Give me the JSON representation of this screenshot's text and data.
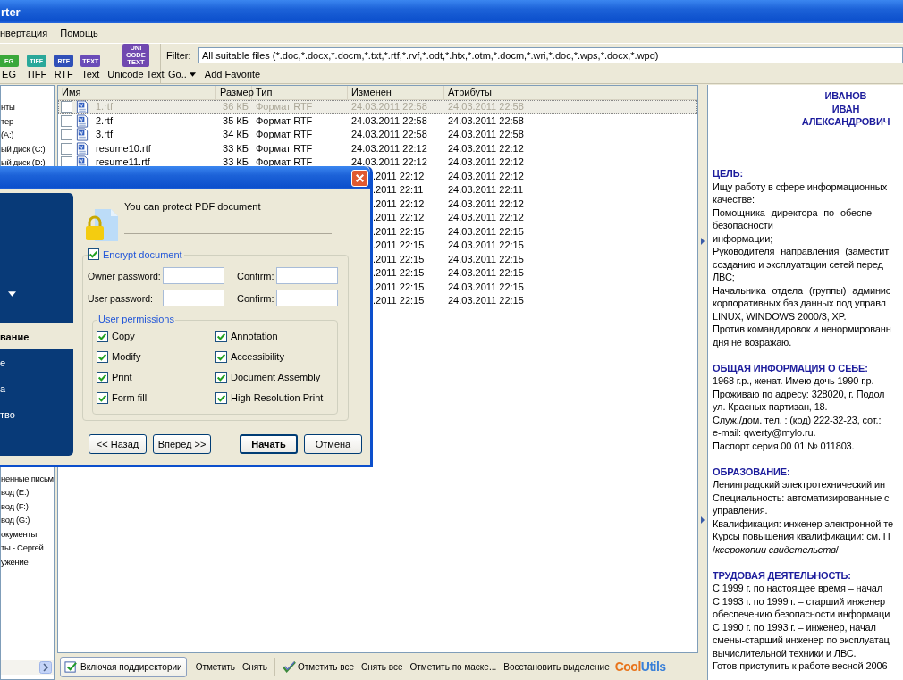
{
  "window": {
    "title": "rter"
  },
  "menu": [
    {
      "label": "нвертация"
    },
    {
      "label": "Помощь"
    }
  ],
  "tools": [
    {
      "label": "EG",
      "icon_text": "EG",
      "color": "#3aa83a"
    },
    {
      "label": "TIFF",
      "icon_text": "TIFF",
      "color": "#2aa89a"
    },
    {
      "label": "RTF",
      "icon_text": "RTF",
      "color": "#3050b8"
    },
    {
      "label": "Text",
      "icon_text": "TEXT",
      "color": "#6a4cb8"
    },
    {
      "label": "Unicode Text",
      "icon_text": "UNI CODE TEXT",
      "color": "#7048b0"
    }
  ],
  "filter": {
    "label": "Filter:",
    "value": "All suitable files (*.doc,*.docx,*.docm,*.txt,*.rtf,*.rvf,*.odt,*.htx,*.otm,*.docm,*.wri,*.doc,*.wps,*.docx,*.wpd)"
  },
  "go": {
    "label": "Go..",
    "add_favorite": "Add Favorite"
  },
  "tree": {
    "items": [
      {
        "label": "нты"
      },
      {
        "label": "тер"
      },
      {
        "label": "(A:)"
      },
      {
        "label": "ый диск (C:)"
      },
      {
        "label": "ый диск (D:)"
      },
      {
        "label": "ненные письм"
      },
      {
        "label": "вод (E:)"
      },
      {
        "label": "вод (F:)"
      },
      {
        "label": "вод (G:)"
      },
      {
        "label": "окументы"
      },
      {
        "label": "ты - Сергей"
      },
      {
        "label": "ужение"
      }
    ]
  },
  "files": {
    "columns": [
      "Имя",
      "Размер",
      "Тип",
      "Изменен",
      "Атрибуты"
    ],
    "rows": [
      {
        "name": "1.rtf",
        "size": "36 КБ",
        "type": "Формат RTF",
        "modified": "24.03.2011 22:58",
        "attributes": "24.03.2011 22:58",
        "checked": false,
        "selected": true
      },
      {
        "name": "2.rtf",
        "size": "35 КБ",
        "type": "Формат RTF",
        "modified": "24.03.2011 22:58",
        "attributes": "24.03.2011 22:58",
        "checked": false,
        "selected": false
      },
      {
        "name": "3.rtf",
        "size": "34 КБ",
        "type": "Формат RTF",
        "modified": "24.03.2011 22:58",
        "attributes": "24.03.2011 22:58",
        "checked": false,
        "selected": false
      },
      {
        "name": "resume10.rtf",
        "size": "33 КБ",
        "type": "Формат RTF",
        "modified": "24.03.2011 22:12",
        "attributes": "24.03.2011 22:12",
        "checked": false,
        "selected": false
      },
      {
        "name": "resume11.rtf",
        "size": "33 КБ",
        "type": "Формат RTF",
        "modified": "24.03.2011 22:12",
        "attributes": "24.03.2011 22:12",
        "checked": false,
        "selected": false
      },
      {
        "modified": ".2011 22:12",
        "attributes": "24.03.2011 22:12",
        "selected": false
      },
      {
        "modified": ".2011 22:11",
        "attributes": "24.03.2011 22:11",
        "selected": false
      },
      {
        "modified": ".2011 22:12",
        "attributes": "24.03.2011 22:12",
        "selected": false
      },
      {
        "modified": ".2011 22:12",
        "attributes": "24.03.2011 22:12",
        "selected": false
      },
      {
        "modified": ".2011 22:15",
        "attributes": "24.03.2011 22:15",
        "selected": false
      },
      {
        "modified": ".2011 22:15",
        "attributes": "24.03.2011 22:15",
        "selected": false
      },
      {
        "modified": ".2011 22:15",
        "attributes": "24.03.2011 22:15",
        "selected": false
      },
      {
        "modified": ".2011 22:15",
        "attributes": "24.03.2011 22:15",
        "selected": false
      },
      {
        "modified": ".2011 22:15",
        "attributes": "24.03.2011 22:15",
        "selected": false
      },
      {
        "modified": ".2011 22:15",
        "attributes": "24.03.2011 22:15",
        "selected": false
      }
    ]
  },
  "dialog": {
    "panel_items": [
      {
        "label": "вание",
        "selected": true
      },
      {
        "label": "е",
        "selected": false
      },
      {
        "label": "а",
        "selected": false
      },
      {
        "label": "тво",
        "selected": false
      }
    ],
    "heading": "You can protect PDF document",
    "encrypt": {
      "label": "Encrypt document",
      "checked": true
    },
    "fields": [
      {
        "label": "Owner password:",
        "confirm_label": "Confirm:"
      },
      {
        "label": "User password:",
        "confirm_label": "Confirm:"
      }
    ],
    "permissions": {
      "title": "User permissions",
      "items": [
        {
          "label": "Copy",
          "checked": true
        },
        {
          "label": "Annotation",
          "checked": true
        },
        {
          "label": "Modify",
          "checked": true
        },
        {
          "label": "Accessibility",
          "checked": true
        },
        {
          "label": "Print",
          "checked": true
        },
        {
          "label": "Document Assembly",
          "checked": true
        },
        {
          "label": "Form fill",
          "checked": true
        },
        {
          "label": "High Resolution Print",
          "checked": true
        }
      ]
    },
    "buttons": [
      {
        "label": "<< Назад",
        "kind": "normal"
      },
      {
        "label": "Вперед >>",
        "kind": "normal"
      },
      {
        "label": "Начать",
        "kind": "default"
      },
      {
        "label": "Отмена",
        "kind": "normal"
      }
    ]
  },
  "document": {
    "lines": [
      {
        "kind": "title",
        "text": "ИВАНОВ"
      },
      {
        "kind": "title",
        "text": "ИВАН"
      },
      {
        "kind": "title",
        "text": "АЛЕКСАНДРОВИЧ"
      },
      {
        "kind": "blank"
      },
      {
        "kind": "blank"
      },
      {
        "kind": "blank"
      },
      {
        "kind": "heading",
        "text": "ЦЕЛЬ:"
      },
      {
        "kind": "text",
        "text": "Ищу работу в сфере информационных"
      },
      {
        "kind": "text",
        "text": "качестве:"
      },
      {
        "kind": "justified",
        "text": " Помощника директора по обеспе"
      },
      {
        "kind": "text",
        "text": "безопасности"
      },
      {
        "kind": "text",
        "text": "информации;"
      },
      {
        "kind": "justified",
        "text": " Руководителя направления (заместит"
      },
      {
        "kind": "text",
        "text": "созданию  и эксплуатации сетей перед"
      },
      {
        "kind": "text",
        "text": "ЛВС;"
      },
      {
        "kind": "justified",
        "text": " Начальника отдела (группы) админис"
      },
      {
        "kind": "text",
        "text": "корпоративных баз данных под управл"
      },
      {
        "kind": "text",
        "text": "LINUX, WINDOWS 2000/3, XP."
      },
      {
        "kind": "text",
        "text": "Против командировок и ненормированн"
      },
      {
        "kind": "text",
        "text": "дня не возражаю."
      },
      {
        "kind": "blank"
      },
      {
        "kind": "heading",
        "text": "ОБЩАЯ ИНФОРМАЦИЯ О СЕБЕ:"
      },
      {
        "kind": "text",
        "text": "1968 г.р., женат. Имею дочь 1990 г.р."
      },
      {
        "kind": "text",
        "text": "Проживаю по адресу:  328020, г. Подол"
      },
      {
        "kind": "text",
        "text": "ул. Красных партизан, 18."
      },
      {
        "kind": "text",
        "text": "Служ./дом. тел. : (код) 222-32-23, сот.:"
      },
      {
        "kind": "text",
        "text": "e-mail: qwerty@mylo.ru."
      },
      {
        "kind": "text",
        "text": "Паспорт серия 00 01 № 011803."
      },
      {
        "kind": "blank"
      },
      {
        "kind": "heading",
        "text": "ОБРАЗОВАНИЕ:"
      },
      {
        "kind": "text",
        "text": "Ленинградский электротехнический ин"
      },
      {
        "kind": "text",
        "text": "Специальность: автоматизированные с"
      },
      {
        "kind": "text",
        "text": "управления."
      },
      {
        "kind": "text",
        "text": "Квалификация: инженер электронной те"
      },
      {
        "kind": "text",
        "text": "Курсы повышения квалификации: см. П"
      },
      {
        "kind": "text",
        "text": "/*ксерокопии свидетельств*/"
      },
      {
        "kind": "blank"
      },
      {
        "kind": "heading",
        "text": "ТРУДОВАЯ ДЕЯТЕЛЬНОСТЬ:"
      },
      {
        "kind": "text",
        "text": "С 1999 г.  по настоящее время – начал"
      },
      {
        "kind": "text",
        "text": "С 1993 г. по 1999 г. – старший инженер"
      },
      {
        "kind": "text",
        "text": "обеспечению безопасности информаци"
      },
      {
        "kind": "text",
        "text": "С 1990 г. по 1993 г. – инженер,  начал"
      },
      {
        "kind": "text",
        "text": "смены-старший инженер по эксплуатац"
      },
      {
        "kind": "text",
        "text": "вычислительной техники и ЛВС."
      },
      {
        "kind": "text",
        "text": "Готов приступить к работе весной 2006"
      }
    ]
  },
  "bottom_bar": {
    "items": [
      {
        "kind": "toggle",
        "label": "Включая поддиректории"
      },
      {
        "kind": "text",
        "label": "Отметить"
      },
      {
        "kind": "text",
        "label": "Снять"
      },
      {
        "kind": "separator"
      },
      {
        "kind": "check",
        "label": "Отметить все"
      },
      {
        "kind": "text",
        "label": "Снять все"
      },
      {
        "kind": "text",
        "label": "Отметить по маске..."
      },
      {
        "kind": "text",
        "label": "Восстановить выделение"
      }
    ],
    "logo": {
      "first": "Cool",
      "rest": "Utils"
    }
  }
}
